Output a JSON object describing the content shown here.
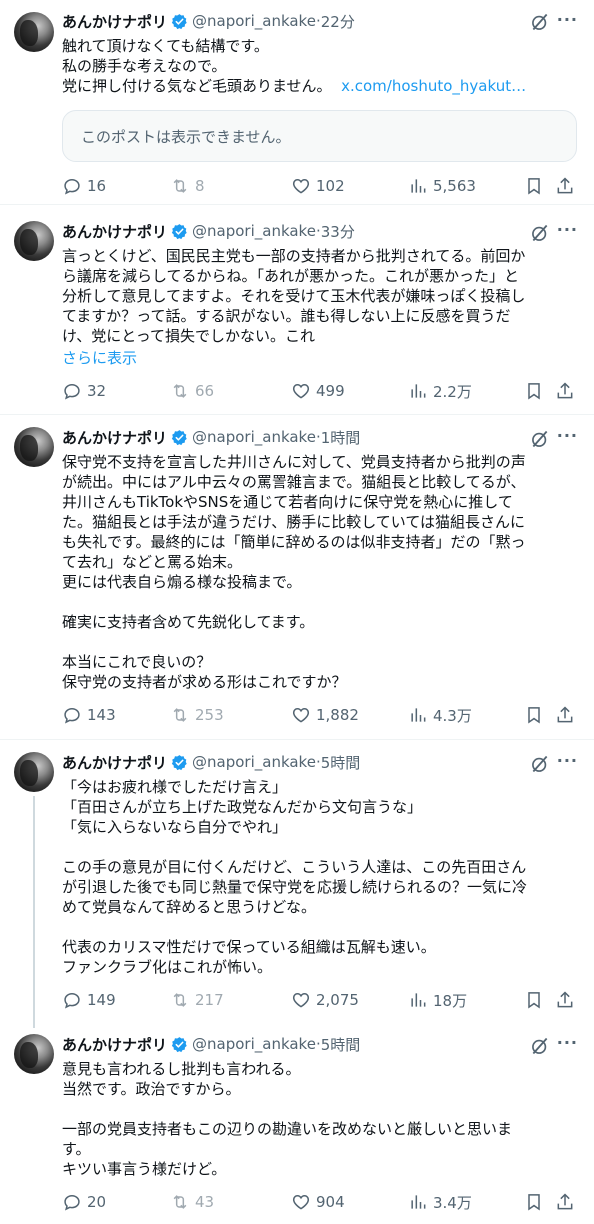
{
  "author": {
    "name": "あんかけナポリ",
    "handle": "@napori_ankake",
    "dot": "·"
  },
  "more_label": "···",
  "tweets": [
    {
      "time": "22分",
      "text": "触れて頂けなくても結構です。\n私の勝手な考えなので。\n党に押し付ける気など毛頭ありません。",
      "link": "x.com/hoshuto_hyakut…",
      "quote_unavailable": "このポストは表示できません。",
      "replies": "16",
      "reposts": "8",
      "likes": "102",
      "views": "5,563"
    },
    {
      "time": "33分",
      "text": "言っとくけど、国民民主党も一部の支持者から批判されてる。前回か\nら議席を減らしてるからね。「あれが悪かった。これが悪かった」と\n分析して意見してますよ。それを受けて玉木代表が嫌味っぽく投稿し\nてますか？って話。する訳がない。誰も得しない上に反感を買うだ\nけ、党にとって損失でしかない。これ",
      "show_more": "さらに表示",
      "replies": "32",
      "reposts": "66",
      "likes": "499",
      "views": "2.2万"
    },
    {
      "time": "1時間",
      "text": "保守党不支持を宣言した井川さんに対して、党員支持者から批判の声\nが続出。中にはアル中云々の罵詈雑言まで。猫組長と比較してるが、\n井川さんもTikTokやSNSを通じて若者向けに保守党を熱心に推して\nた。猫組長とは手法が違うだけ、勝手に比較していては猫組長さんに\nも失礼です。最終的には「簡単に辞めるのは似非支持者」だの「黙っ\nて去れ」などと罵る始末。\n更には代表自ら煽る様な投稿まで。\n\n確実に支持者含めて先鋭化してます。\n\n本当にこれで良いの？\n保守党の支持者が求める形はこれですか？",
      "replies": "143",
      "reposts": "253",
      "likes": "1,882",
      "views": "4.3万"
    },
    {
      "time": "5時間",
      "text": "「今はお疲れ様でしただけ言え」\n「百田さんが立ち上げた政党なんだから文句言うな」\n「気に入らないなら自分でやれ」\n\nこの手の意見が目に付くんだけど、こういう人達は、この先百田さん\nが引退した後でも同じ熱量で保守党を応援し続けられるの？一気に冷\nめて党員なんて辞めると思うけどな。\n\n代表のカリスマ性だけで保っている組織は瓦解も速い。\nファンクラブ化はこれが怖い。",
      "replies": "149",
      "reposts": "217",
      "likes": "2,075",
      "views": "18万"
    },
    {
      "time": "5時間",
      "text": "意見も言われるし批判も言われる。\n当然です。政治ですから。\n\n一部の党員支持者もこの辺りの勘違いを改めないと厳しいと思いま\nす。\nキツい事言う様だけど。",
      "replies": "20",
      "reposts": "43",
      "likes": "904",
      "views": "3.4万"
    }
  ],
  "colors": {
    "text": "#0f1419",
    "muted": "#536471",
    "link": "#1d9bf0",
    "verified": "#1d9bf0",
    "separator": "#eff3f4"
  }
}
